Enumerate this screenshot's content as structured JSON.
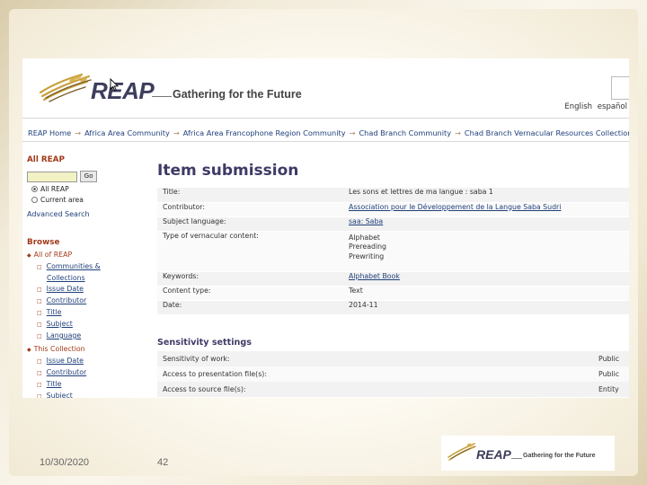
{
  "header": {
    "logo_text": "REAP",
    "tagline": "Gathering for the Future",
    "languages": [
      "English",
      "español"
    ]
  },
  "breadcrumb": [
    "REAP Home",
    "Africa Area Community",
    "Africa Area Francophone Region Community",
    "Chad Branch Community",
    "Chad Branch Vernacular Resources Collection"
  ],
  "sidebar": {
    "all_heading": "All REAP",
    "go_label": "Go",
    "scope_options": [
      {
        "label": "All REAP",
        "selected": true
      },
      {
        "label": "Current area",
        "selected": false
      }
    ],
    "advanced_search": "Advanced Search",
    "browse_heading": "Browse",
    "all_group": {
      "title": "All of REAP",
      "items": [
        "Communities &",
        "Collections",
        "Issue Date",
        "Contributor",
        "Title",
        "Subject",
        "Language"
      ]
    },
    "collection_group": {
      "title": "This Collection",
      "items": [
        "Issue Date",
        "Contributor",
        "Title",
        "Subject"
      ]
    }
  },
  "main": {
    "title": "Item submission",
    "fields": [
      {
        "key": "Title:",
        "value": [
          "Les sons et lettres de ma langue : saba 1"
        ],
        "link": false
      },
      {
        "key": "Contributor:",
        "value": [
          "Association pour le Développement de la Langue Saba Sudri"
        ],
        "link": true
      },
      {
        "key": "Subject language:",
        "value": [
          "saa: Saba"
        ],
        "link": true
      },
      {
        "key": "Type of vernacular content:",
        "value": [
          "Alphabet",
          "Prereading",
          "Prewriting"
        ],
        "link": false
      },
      {
        "key": "Keywords:",
        "value": [
          "Alphabet Book"
        ],
        "link": true
      },
      {
        "key": "Content type:",
        "value": [
          "Text"
        ],
        "link": false
      },
      {
        "key": "Date:",
        "value": [
          "2014-11"
        ],
        "link": false
      }
    ],
    "sensitivity_heading": "Sensitivity settings",
    "sensitivity": [
      {
        "key": "Sensitivity of work:",
        "value": "Public"
      },
      {
        "key": "Access to presentation file(s):",
        "value": "Public"
      },
      {
        "key": "Access to source file(s):",
        "value": "Entity"
      }
    ]
  },
  "slide": {
    "date": "10/30/2020",
    "page_number": "42",
    "footer_logo_text": "REAP",
    "footer_tagline": "Gathering for the Future"
  },
  "colors": {
    "brand_navy": "#3e3a66",
    "link_blue": "#1f3f7a",
    "sidebar_heading": "#a13a1a",
    "search_field": "#f2f2c4"
  }
}
